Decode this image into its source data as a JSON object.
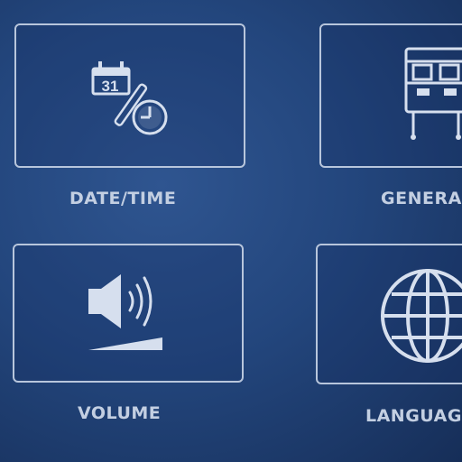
{
  "menu": {
    "items": [
      {
        "id": "datetime",
        "label": "DATE/TIME",
        "icon": "calendar-clock-icon"
      },
      {
        "id": "general",
        "label": "GENERA",
        "icon": "general-settings-icon"
      },
      {
        "id": "volume",
        "label": "VOLUME",
        "icon": "speaker-volume-icon"
      },
      {
        "id": "language",
        "label": "LANGUAG",
        "icon": "globe-icon"
      }
    ],
    "calendar_day": "31"
  },
  "colors": {
    "background": "#23467d",
    "foreground": "#c3cfe2",
    "border": "#b8c6dc"
  }
}
